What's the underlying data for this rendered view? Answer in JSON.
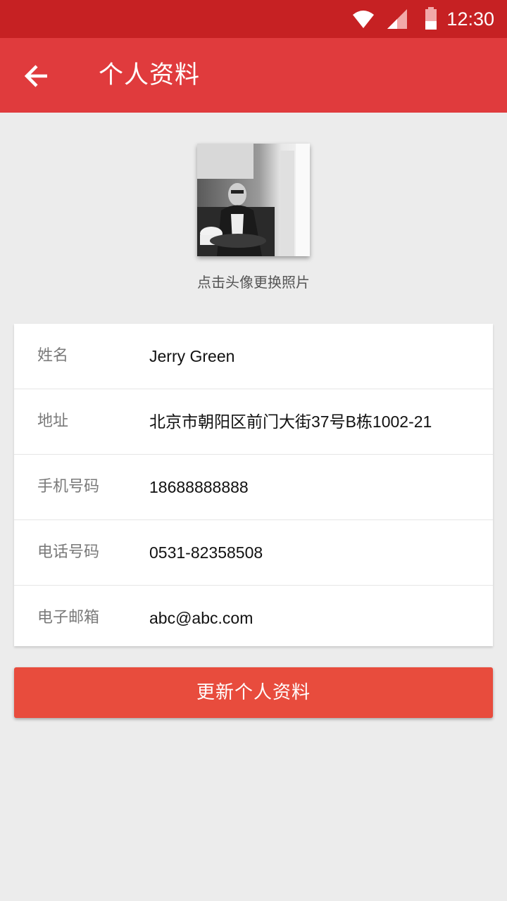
{
  "status_bar": {
    "time": "12:30",
    "icons": [
      "wifi-icon",
      "signal-icon",
      "battery-icon"
    ]
  },
  "app_bar": {
    "back_icon": "arrow-left-icon",
    "title": "个人资料"
  },
  "profile": {
    "avatar_hint": "点击头像更换照片"
  },
  "fields": [
    {
      "label": "姓名",
      "value": "Jerry Green"
    },
    {
      "label": "地址",
      "value": "北京市朝阳区前门大街37号B栋1002-21"
    },
    {
      "label": "手机号码",
      "value": "18688888888"
    },
    {
      "label": "电话号码",
      "value": "0531-82358508"
    },
    {
      "label": "电子邮箱",
      "value": "abc@abc.com"
    }
  ],
  "submit": {
    "label": "更新个人资料"
  },
  "colors": {
    "status_bar": "#c62123",
    "app_bar": "#e03b3d",
    "button": "#e84c3d",
    "background": "#ececec"
  }
}
